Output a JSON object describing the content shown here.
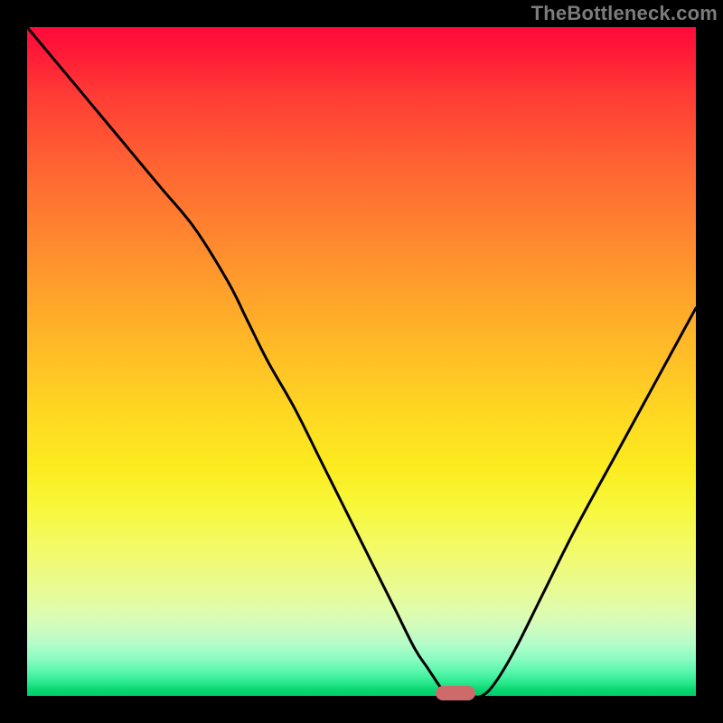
{
  "watermark": "TheBottleneck.com",
  "chart_data": {
    "type": "line",
    "title": "",
    "xlabel": "",
    "ylabel": "",
    "xlim": [
      0,
      100
    ],
    "ylim": [
      0,
      100
    ],
    "grid": false,
    "series": [
      {
        "name": "bottleneck-curve",
        "x": [
          0,
          5,
          10,
          15,
          20,
          25,
          30,
          33,
          36,
          40,
          44,
          48,
          52,
          55,
          58,
          60,
          62,
          63,
          64,
          66,
          68,
          70,
          73,
          77,
          82,
          88,
          94,
          100
        ],
        "values": [
          100,
          94,
          88,
          82,
          76,
          70,
          62,
          56,
          50,
          43,
          35,
          27,
          19,
          13,
          7,
          4,
          1,
          0,
          0,
          0,
          0,
          2,
          7,
          15,
          25,
          36,
          47,
          58
        ]
      }
    ],
    "marker": {
      "x": 64,
      "y": 0,
      "color": "#cf6a6a"
    },
    "background_gradient": {
      "top": "#ff0a3a",
      "mid": "#ffd822",
      "bottom": "#02cd66"
    }
  }
}
